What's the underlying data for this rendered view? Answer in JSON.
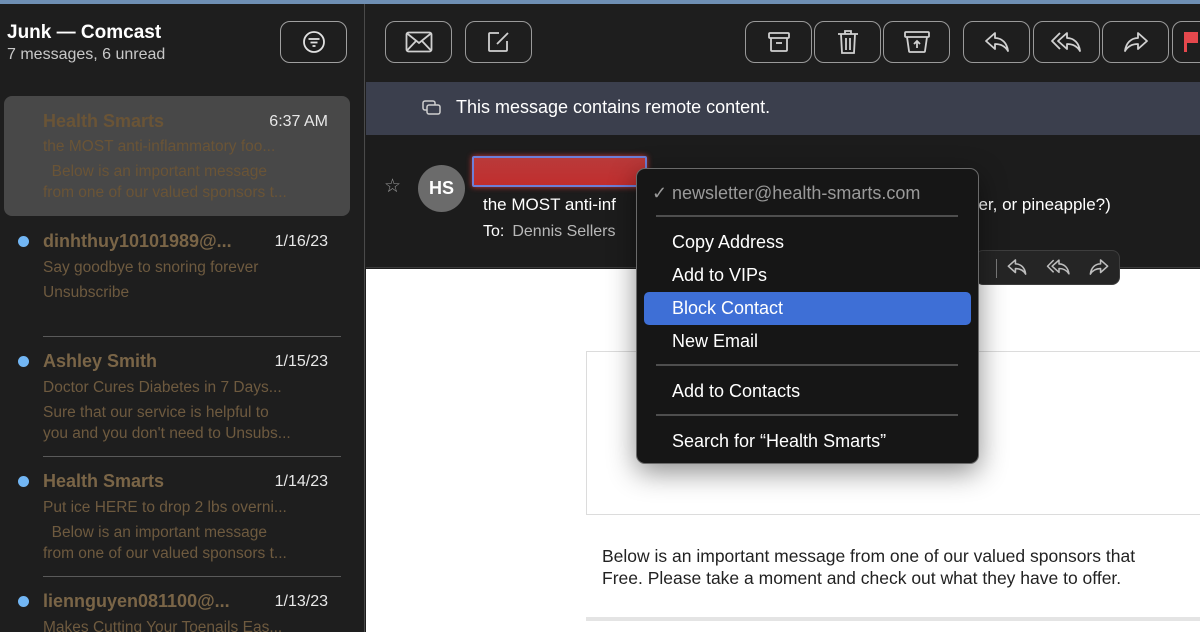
{
  "sidebar": {
    "title": "Junk — Comcast",
    "subtitle": "7 messages, 6 unread",
    "filter_icon": "filter-icon",
    "messages": [
      {
        "sender": "Health Smarts",
        "date": "6:37 AM",
        "line1": "the MOST anti-inflammatory foo...",
        "line2": "  Below is an important message",
        "line3": "from one of our valued sponsors t...",
        "unread": false,
        "selected": true
      },
      {
        "sender": "dinhthuy10101989@...",
        "date": "1/16/23",
        "line1": "Say goodbye to snoring forever",
        "line2": "Unsubscribe",
        "line3": "",
        "unread": true,
        "selected": false
      },
      {
        "sender": "Ashley Smith",
        "date": "1/15/23",
        "line1": "Doctor Cures Diabetes in 7 Days...",
        "line2": "Sure that our service is helpful to",
        "line3": "you and you don't need to Unsubs...",
        "unread": true,
        "selected": false
      },
      {
        "sender": "Health Smarts",
        "date": "1/14/23",
        "line1": "Put ice HERE to drop 2 lbs overni...",
        "line2": "  Below is an important message",
        "line3": "from one of our valued sponsors t...",
        "unread": true,
        "selected": false
      },
      {
        "sender": "liennguyen081100@...",
        "date": "1/13/23",
        "line1": "Makes Cutting Your Toenails Eas...",
        "line2": "",
        "line3": "",
        "unread": true,
        "selected": false
      }
    ]
  },
  "toolbar": {
    "buttons": [
      "get-mail",
      "compose",
      "archive",
      "trash",
      "move-to-junk",
      "reply",
      "reply-all",
      "forward",
      "flag"
    ]
  },
  "banner": {
    "text": "This message contains remote content."
  },
  "message": {
    "avatar_initials": "HS",
    "sender_redacted": true,
    "subject_start": "the MOST anti-inf",
    "subject_end": "ber, or pineapple?)",
    "to_label": "To:",
    "to_value": "Dennis Sellers"
  },
  "body": {
    "line1": "Below is an important message from one of our valued sponsors that",
    "line2": "Free. Please take a moment and check out what they have to offer."
  },
  "context_menu": {
    "address": "newsletter@health-smarts.com",
    "check": "✓",
    "items": [
      {
        "label": "Copy Address"
      },
      {
        "label": "Add to VIPs"
      },
      {
        "label": "Block Contact",
        "active": true
      },
      {
        "label": "New Email"
      },
      {
        "label": "Add to Contacts"
      },
      {
        "label": "Search for “Health Smarts”"
      }
    ]
  },
  "colors": {
    "accent": "#3e6fd6",
    "unread_dot": "#72b6f4",
    "banner_bg": "#3b3f4d",
    "flag": "#e5484d"
  }
}
